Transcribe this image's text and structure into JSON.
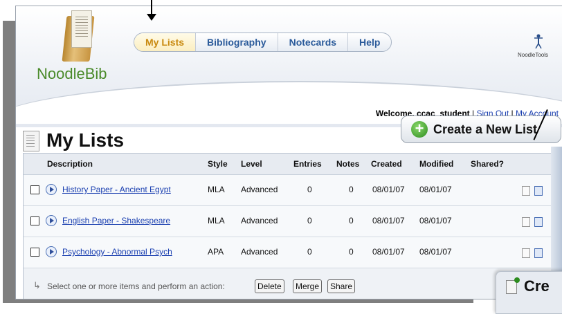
{
  "app": {
    "logo_text": "NoodleBib",
    "vendor_text": "NoodleTools"
  },
  "nav": {
    "items": [
      {
        "label": "My Lists",
        "active": true
      },
      {
        "label": "Bibliography",
        "active": false
      },
      {
        "label": "Notecards",
        "active": false
      },
      {
        "label": "Help",
        "active": false
      }
    ]
  },
  "account": {
    "welcome": "Welcome, ccac_student",
    "separator": " | ",
    "sign_out": "Sign Out",
    "my_account": "My Account"
  },
  "page": {
    "title": "My Lists",
    "create_button": "Create a New List"
  },
  "table": {
    "headers": {
      "description": "Description",
      "style": "Style",
      "level": "Level",
      "entries": "Entries",
      "notes": "Notes",
      "created": "Created",
      "modified": "Modified",
      "shared": "Shared?"
    },
    "rows": [
      {
        "description": "History Paper - Ancient Egypt",
        "style": "MLA",
        "level": "Advanced",
        "entries": "0",
        "notes": "0",
        "created": "08/01/07",
        "modified": "08/01/07"
      },
      {
        "description": "English Paper - Shakespeare",
        "style": "MLA",
        "level": "Advanced",
        "entries": "0",
        "notes": "0",
        "created": "08/01/07",
        "modified": "08/01/07"
      },
      {
        "description": "Psychology - Abnormal Psych",
        "style": "APA",
        "level": "Advanced",
        "entries": "0",
        "notes": "0",
        "created": "08/01/07",
        "modified": "08/01/07"
      }
    ]
  },
  "footer": {
    "instruction": "Select one or more items and perform an action:",
    "actions": {
      "delete": "Delete",
      "merge": "Merge",
      "share": "Share"
    }
  },
  "overlay": {
    "text": "Cre"
  },
  "colors": {
    "nav_active": "#c98a0f",
    "link": "#1a3fb0",
    "logo_green": "#4a8a2a"
  }
}
